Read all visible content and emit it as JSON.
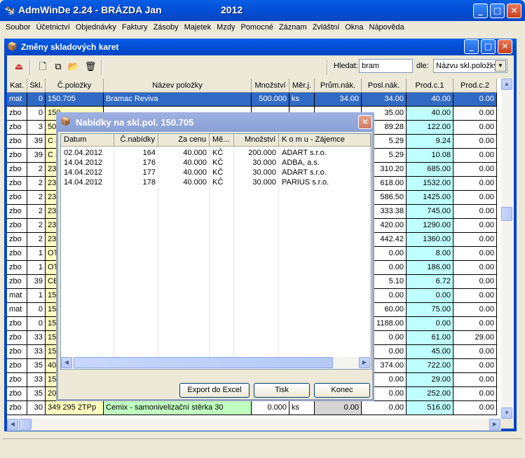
{
  "app": {
    "title": "AdmWinDe 2.24 - BRÁZDA Jan",
    "year": "2012",
    "minimize": "_",
    "maximize": "□",
    "close": "✕"
  },
  "menu": [
    "Soubor",
    "Účetnictví",
    "Objednávky",
    "Faktury",
    "Zásoby",
    "Majetek",
    "Mzdy",
    "Pomocné",
    "Záznam",
    "Zvláštní",
    "Okna",
    "Nápověda"
  ],
  "child": {
    "title": "Změny skladových karet",
    "search_label": "Hledat:",
    "search_value": "bram",
    "by_label": "dle:",
    "by_value": "Názvu skl.položky"
  },
  "grid": {
    "headers": [
      "Kat.",
      "Skl.",
      "Č.položky",
      "Název položky",
      "Množství",
      "Měr.j.",
      "Prům.nák.",
      "Posl.nák.",
      "Prod.c.1",
      "Prod.c.2"
    ],
    "rows": [
      {
        "kat": "mat",
        "skl": "0",
        "cislo": "150.705",
        "nazev": "Bramac Reviva",
        "mnozstvi": "500.000",
        "mj": "ks",
        "prum": "34.00",
        "posl": "34.00",
        "p1": "40.00",
        "p2": "0.00"
      },
      {
        "kat": "zbo",
        "skl": "0",
        "cislo": "150",
        "nazev": "",
        "mnozstvi": "",
        "mj": "",
        "prum": "",
        "posl": "35.00",
        "p1": "40.00",
        "p2": "0.00"
      },
      {
        "kat": "zbo",
        "skl": "3",
        "cislo": "50",
        "nazev": "",
        "mnozstvi": "",
        "mj": "",
        "prum": "",
        "posl": "89.28",
        "p1": "122.00",
        "p2": "0.00"
      },
      {
        "kat": "zbo",
        "skl": "39",
        "cislo": "C 3",
        "nazev": "",
        "mnozstvi": "",
        "mj": "",
        "prum": "",
        "posl": "5.29",
        "p1": "9.24",
        "p2": "0.00"
      },
      {
        "kat": "zbo",
        "skl": "39",
        "cislo": "C 3",
        "nazev": "",
        "mnozstvi": "",
        "mj": "",
        "prum": "",
        "posl": "5.29",
        "p1": "10.08",
        "p2": "0.00"
      },
      {
        "kat": "zbo",
        "skl": "2",
        "cislo": "23",
        "nazev": "",
        "mnozstvi": "",
        "mj": "",
        "prum": "",
        "posl": "310.20",
        "p1": "685.00",
        "p2": "0.00"
      },
      {
        "kat": "zbo",
        "skl": "2",
        "cislo": "23",
        "nazev": "",
        "mnozstvi": "",
        "mj": "",
        "prum": "",
        "posl": "618.00",
        "p1": "1532.00",
        "p2": "0.00"
      },
      {
        "kat": "zbo",
        "skl": "2",
        "cislo": "23",
        "nazev": "",
        "mnozstvi": "",
        "mj": "",
        "prum": "",
        "posl": "586.50",
        "p1": "1425.00",
        "p2": "0.00"
      },
      {
        "kat": "zbo",
        "skl": "2",
        "cislo": "23",
        "nazev": "",
        "mnozstvi": "",
        "mj": "",
        "prum": "",
        "posl": "333.38",
        "p1": "745.00",
        "p2": "0.00"
      },
      {
        "kat": "zbo",
        "skl": "2",
        "cislo": "23",
        "nazev": "",
        "mnozstvi": "",
        "mj": "",
        "prum": "",
        "posl": "420.00",
        "p1": "1290.00",
        "p2": "0.00"
      },
      {
        "kat": "zbo",
        "skl": "2",
        "cislo": "23",
        "nazev": "",
        "mnozstvi": "",
        "mj": "",
        "prum": "",
        "posl": "442.42",
        "p1": "1360.00",
        "p2": "0.00"
      },
      {
        "kat": "zbo",
        "skl": "1",
        "cislo": "OT",
        "nazev": "",
        "mnozstvi": "",
        "mj": "",
        "prum": "",
        "posl": "0.00",
        "p1": "8.00",
        "p2": "0.00"
      },
      {
        "kat": "zbo",
        "skl": "1",
        "cislo": "OT",
        "nazev": "",
        "mnozstvi": "",
        "mj": "",
        "prum": "",
        "posl": "0.00",
        "p1": "186.00",
        "p2": "0.00"
      },
      {
        "kat": "zbo",
        "skl": "39",
        "cislo": "CE",
        "nazev": "",
        "mnozstvi": "",
        "mj": "",
        "prum": "",
        "posl": "5.10",
        "p1": "6.72",
        "p2": "0.00"
      },
      {
        "kat": "mat",
        "skl": "1",
        "cislo": "15",
        "nazev": "",
        "mnozstvi": "",
        "mj": "",
        "prum": "",
        "posl": "0.00",
        "p1": "0.00",
        "p2": "0.00"
      },
      {
        "kat": "mat",
        "skl": "0",
        "cislo": "15",
        "nazev": "",
        "mnozstvi": "",
        "mj": "",
        "prum": "",
        "posl": "60.00",
        "p1": "75.00",
        "p2": "0.00"
      },
      {
        "kat": "zbo",
        "skl": "0",
        "cislo": "15",
        "nazev": "",
        "mnozstvi": "",
        "mj": "",
        "prum": "",
        "posl": "1188.00",
        "p1": "0.00",
        "p2": "0.00"
      },
      {
        "kat": "zbo",
        "skl": "33",
        "cislo": "15",
        "nazev": "",
        "mnozstvi": "",
        "mj": "",
        "prum": "",
        "posl": "0.00",
        "p1": "61.00",
        "p2": "29.00"
      },
      {
        "kat": "zbo",
        "skl": "33",
        "cislo": "15",
        "nazev": "",
        "mnozstvi": "",
        "mj": "",
        "prum": "",
        "posl": "0.00",
        "p1": "45.00",
        "p2": "0.00"
      },
      {
        "kat": "zbo",
        "skl": "35",
        "cislo": "40",
        "nazev": "",
        "mnozstvi": "",
        "mj": "",
        "prum": "",
        "posl": "374.00",
        "p1": "722.00",
        "p2": "0.00"
      },
      {
        "kat": "zbo",
        "skl": "33",
        "cislo": "15",
        "nazev": "",
        "mnozstvi": "",
        "mj": "",
        "prum": "",
        "posl": "0.00",
        "p1": "29.00",
        "p2": "0.00"
      },
      {
        "kat": "zbo",
        "skl": "35",
        "cislo": "20",
        "nazev": "",
        "mnozstvi": "",
        "mj": "",
        "prum": "",
        "posl": "0.00",
        "p1": "252.00",
        "p2": "0.00"
      },
      {
        "kat": "zbo",
        "skl": "30",
        "cislo": "349 295 2TPp",
        "nazev": "Cemix - samonivelizační stěrka 30",
        "mnozstvi": "0.000",
        "mj": "ks",
        "prum": "0.00",
        "posl": "0.00",
        "p1": "516.00",
        "p2": "0.00"
      }
    ]
  },
  "dialog": {
    "title": "Nabídky na skl.pol. 150.705",
    "headers": [
      "Datum",
      "Č.nabídky",
      "Za cenu",
      "Mě...",
      "Množství",
      "K o m u  - Zájemce"
    ],
    "rows": [
      {
        "datum": "02.04.2012",
        "cislo": "164",
        "cena": "40.000",
        "mena": "KČ",
        "mnozstvi": "200.000",
        "komu": "ADART s.r.o."
      },
      {
        "datum": "14.04.2012",
        "cislo": "176",
        "cena": "40.000",
        "mena": "KČ",
        "mnozstvi": "30.000",
        "komu": "ADBA, a.s."
      },
      {
        "datum": "14.04.2012",
        "cislo": "177",
        "cena": "40.000",
        "mena": "KČ",
        "mnozstvi": "30.000",
        "komu": "ADART s.r.o."
      },
      {
        "datum": "14.04.2012",
        "cislo": "178",
        "cena": "40.000",
        "mena": "KČ",
        "mnozstvi": "30.000",
        "komu": "PARIUS s.r.o."
      }
    ],
    "export_label": "Export do Excel",
    "print_label": "Tisk",
    "end_label": "Konec"
  }
}
